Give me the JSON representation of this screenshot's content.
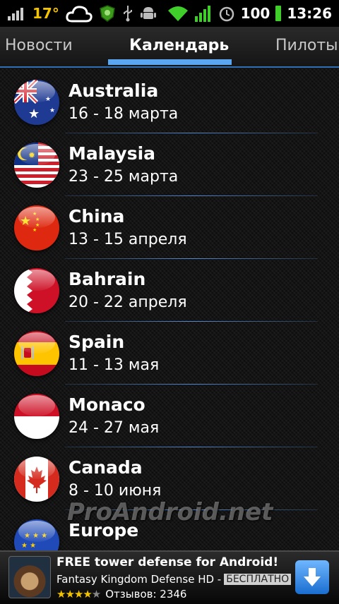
{
  "status_bar": {
    "temperature": "17°",
    "battery": "100",
    "time": "13:26"
  },
  "tabs": [
    {
      "label": "Новости",
      "active": false
    },
    {
      "label": "Календарь",
      "active": true
    },
    {
      "label": "Пилоты",
      "active": false
    }
  ],
  "races": [
    {
      "country": "Australia",
      "dates": "16 - 18 марта"
    },
    {
      "country": "Malaysia",
      "dates": "23 - 25 марта"
    },
    {
      "country": "China",
      "dates": "13 - 15 апреля"
    },
    {
      "country": "Bahrain",
      "dates": "20 - 22 апреля"
    },
    {
      "country": "Spain",
      "dates": "11 - 13 мая"
    },
    {
      "country": "Monaco",
      "dates": "24 - 27 мая"
    },
    {
      "country": "Canada",
      "dates": "8 - 10 июня"
    },
    {
      "country": "Europe",
      "dates": ""
    }
  ],
  "watermark": "ProAndroid.net",
  "ad": {
    "title": "FREE tower defense for Android!",
    "app_name": "Fantasy Kingdom Defense HD -",
    "price_badge": "БЕСПЛАТНО",
    "rating_stars": "★★★★",
    "rating_empty": "★",
    "reviews": "Отзывов: 2346"
  }
}
